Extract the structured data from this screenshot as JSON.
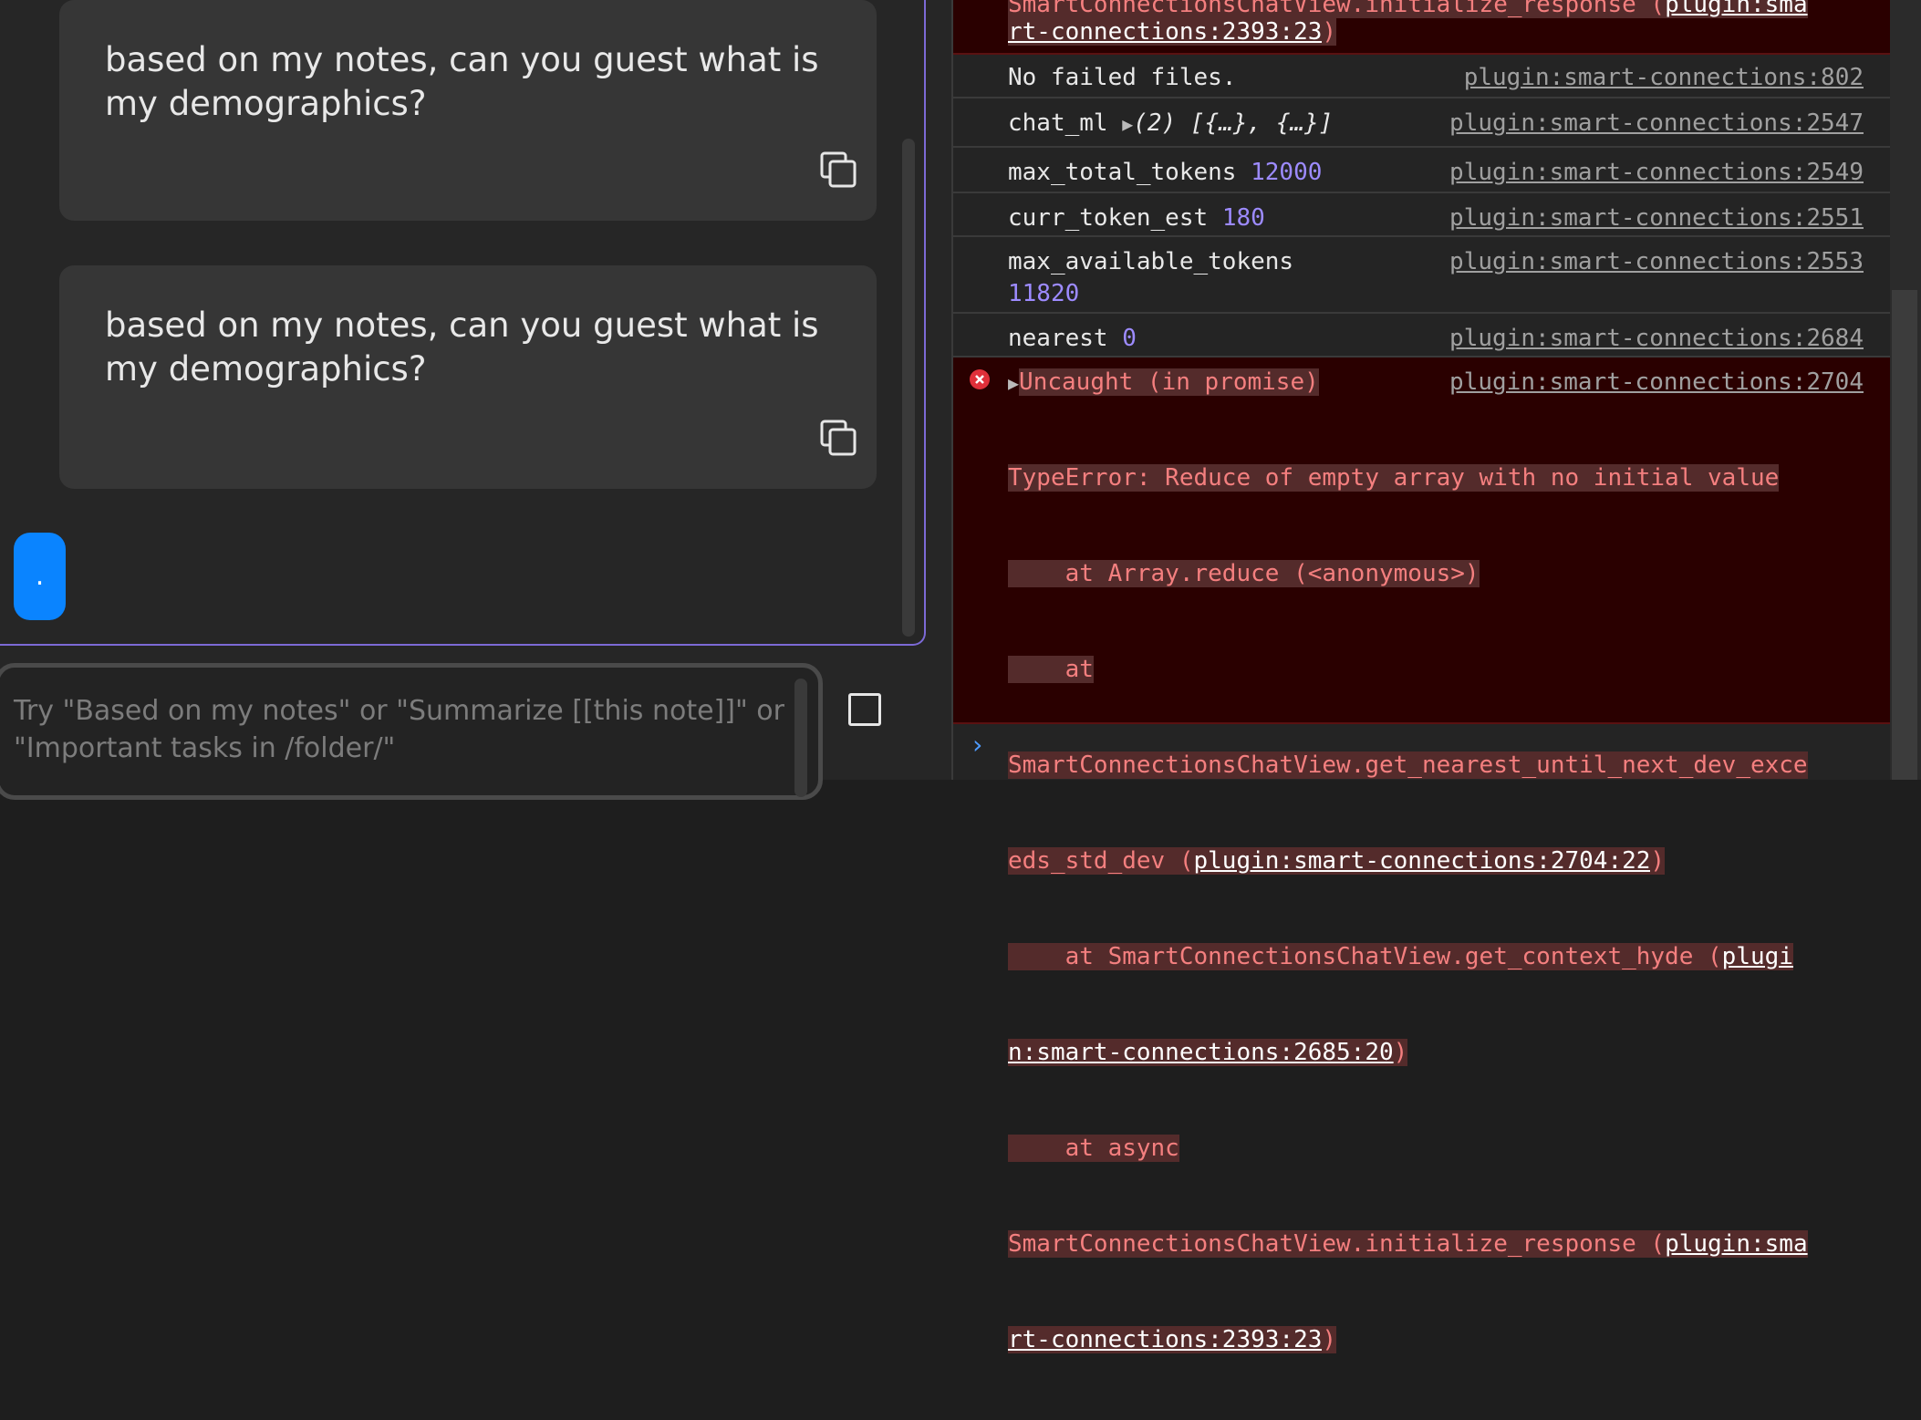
{
  "chat": {
    "messages": [
      {
        "text": "based on my notes, can you guest what is my demographics?"
      },
      {
        "text": "based on my notes, can you guest what is my demographics?"
      }
    ],
    "typing_indicator": ".",
    "input_placeholder": "Try \"Based on my notes\" or \"Summarize [[this note]]\" or \"Important tasks in /folder/\""
  },
  "console": {
    "top_error": {
      "line1": "SmartConnectionsChatView.initialize_response (",
      "link1": "plugin:sma",
      "link2": "rt-connections:2393:23",
      "close": ")"
    },
    "logs": [
      {
        "label": "No failed files.",
        "value": "",
        "source": "plugin:smart-connections:802"
      },
      {
        "label": "chat_ml",
        "value": "(2) [{…}, {…}]",
        "source": "plugin:smart-connections:2547"
      },
      {
        "label": "max_total_tokens",
        "value": "12000",
        "source": "plugin:smart-connections:2549"
      },
      {
        "label": "curr_token_est",
        "value": "180",
        "source": "plugin:smart-connections:2551"
      },
      {
        "label": "max_available_tokens",
        "value": "11820",
        "source": "plugin:smart-connections:2553"
      },
      {
        "label": "nearest",
        "value": "0",
        "source": "plugin:smart-connections:2684"
      }
    ],
    "uncaught": {
      "title": "Uncaught (in promise)",
      "source": "plugin:smart-connections:2704",
      "l1": "TypeError: Reduce of empty array with no initial value",
      "l2": "    at Array.reduce (<anonymous>)",
      "l3": "    at",
      "l4": "SmartConnectionsChatView.get_nearest_until_next_dev_exce",
      "l5a": "eds_std_dev (",
      "l5link": "plugin:smart-connections:2704:22",
      "l5b": ")",
      "l6a": "    at SmartConnectionsChatView.get_context_hyde (",
      "l6link": "plugi",
      "l7link": "n:smart-connections:2685:20",
      "l7b": ")",
      "l8": "    at async",
      "l9a": "SmartConnectionsChatView.initialize_response (",
      "l9link": "plugin:sma",
      "l10link": "rt-connections:2393:23",
      "l10b": ")"
    },
    "prompt_caret": "›",
    "colors": {
      "error_bg": "#2a0000",
      "error_text": "#f47f7f",
      "number": "#9d8bff",
      "accent": "#7c6ad6",
      "indicator": "#0a84ff"
    }
  }
}
